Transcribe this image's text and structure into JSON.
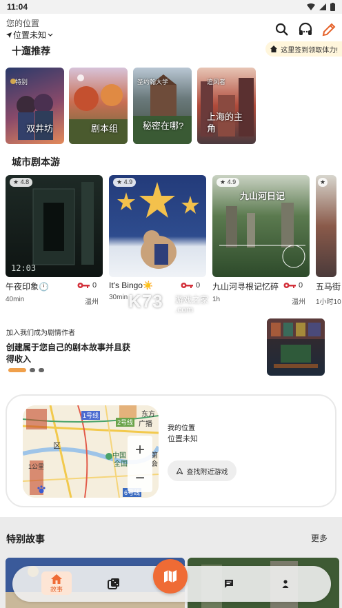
{
  "status_bar": {
    "time": "11:04"
  },
  "header": {
    "location_label": "您的位置",
    "location_value": "位置未知"
  },
  "checkin": {
    "text": "这里签到领取体力!"
  },
  "recommend": {
    "title": "十遛推荐",
    "cards": [
      {
        "tag": "特别",
        "title": "双井坊"
      },
      {
        "tag": "",
        "title": "剧本组"
      },
      {
        "tag": "圣约翰大学",
        "title": "秘密在哪?"
      },
      {
        "tag": "追风者",
        "title": "上海的主角"
      }
    ]
  },
  "city": {
    "title": "城市剧本游",
    "cards": [
      {
        "rating": "4.8",
        "name": "午夜印象🕛",
        "keys": "0",
        "duration": "40min",
        "city": "温州",
        "img_text": "12:03"
      },
      {
        "rating": "4.9",
        "name": "It's Bingo☀️",
        "keys": "0",
        "duration": "30min",
        "city": "",
        "img_text": ""
      },
      {
        "rating": "4.9",
        "name": "九山河寻根记忆碎",
        "keys": "0",
        "duration": "1h",
        "city": "温州",
        "img_text": "九山河日记"
      },
      {
        "rating": "",
        "name": "五马街",
        "keys": "",
        "duration": "1小时10",
        "city": "",
        "img_text": ""
      }
    ]
  },
  "creator": {
    "small": "加入我们成为剧情作者",
    "big": "创建属于您自己的剧本故事并且获得收入"
  },
  "map": {
    "my_location_label": "我的位置",
    "my_location_value": "位置未知",
    "nearby_button": "查找附近游戏",
    "zoom_in": "+",
    "zoom_out": "−",
    "map_labels": [
      "1号线",
      "2号线",
      "东方",
      "广播",
      "区",
      "中国",
      "全国",
      "第",
      "会",
      "6号线",
      "1公里"
    ]
  },
  "special": {
    "title": "特别故事",
    "more": "更多"
  },
  "nav": {
    "home_label": "故事"
  },
  "watermark": {
    "main": "K73",
    "sub": "游戏之家",
    "com": ".com"
  },
  "colors": {
    "accent": "#ef6b35",
    "progress_dot": "#f0a04b"
  }
}
